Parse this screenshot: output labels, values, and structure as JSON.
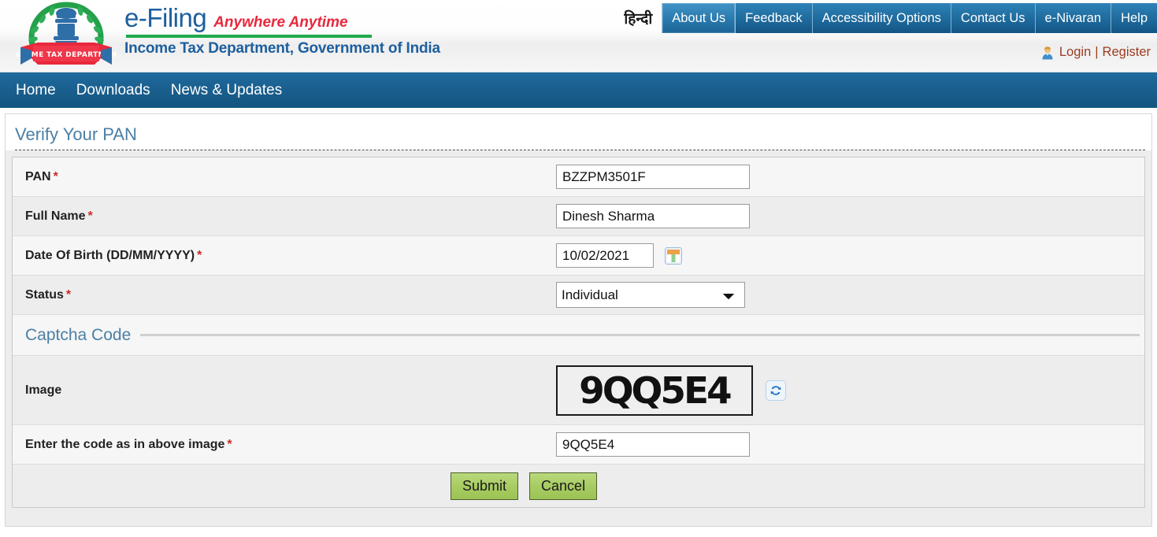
{
  "header": {
    "emblem_alt": "Income Tax Department emblem",
    "brand_title": "e-Filing",
    "brand_tagline": "Anywhere Anytime",
    "brand_department": "Income Tax Department, Government of India",
    "hindi_label": "हिन्दी",
    "top_nav": [
      {
        "label": "About Us",
        "active": true
      },
      {
        "label": "Feedback",
        "active": false
      },
      {
        "label": "Accessibility Options",
        "active": false
      },
      {
        "label": "Contact Us",
        "active": false
      },
      {
        "label": "e-Nivaran",
        "active": false
      },
      {
        "label": "Help",
        "active": false
      }
    ],
    "auth": {
      "login_label": "Login",
      "separator": "|",
      "register_label": "Register"
    }
  },
  "main_nav": [
    {
      "label": "Home"
    },
    {
      "label": "Downloads"
    },
    {
      "label": "News & Updates"
    }
  ],
  "page": {
    "title": "Verify Your PAN"
  },
  "form": {
    "fields": [
      {
        "label": "PAN",
        "required_mark": "*",
        "value": "BZZPM3501F"
      },
      {
        "label": "Full Name",
        "required_mark": "*",
        "value": "Dinesh Sharma"
      },
      {
        "label": "Date Of Birth (DD/MM/YYYY)",
        "required_mark": "*",
        "value": "10/02/2021"
      },
      {
        "label": "Status",
        "required_mark": "*",
        "value": "Individual",
        "options": [
          "Individual"
        ]
      }
    ]
  },
  "captcha": {
    "section_title": "Captcha Code",
    "image_label": "Image",
    "image_text": "9QQ5E4",
    "input_label": "Enter the code as in above image",
    "input_required_mark": "*",
    "input_value": "9QQ5E4"
  },
  "actions": {
    "submit_label": "Submit",
    "cancel_label": "Cancel"
  },
  "colors": {
    "brand_blue": "#1d5f9e",
    "brand_red": "#e8283c",
    "brand_green": "#1faa4b",
    "nav_blue": "#1a5f8e",
    "required_red": "#cc2a2a",
    "auth_link": "#9c3b20",
    "button_green": "#a8cc63",
    "section_title": "#4a7fa5"
  }
}
